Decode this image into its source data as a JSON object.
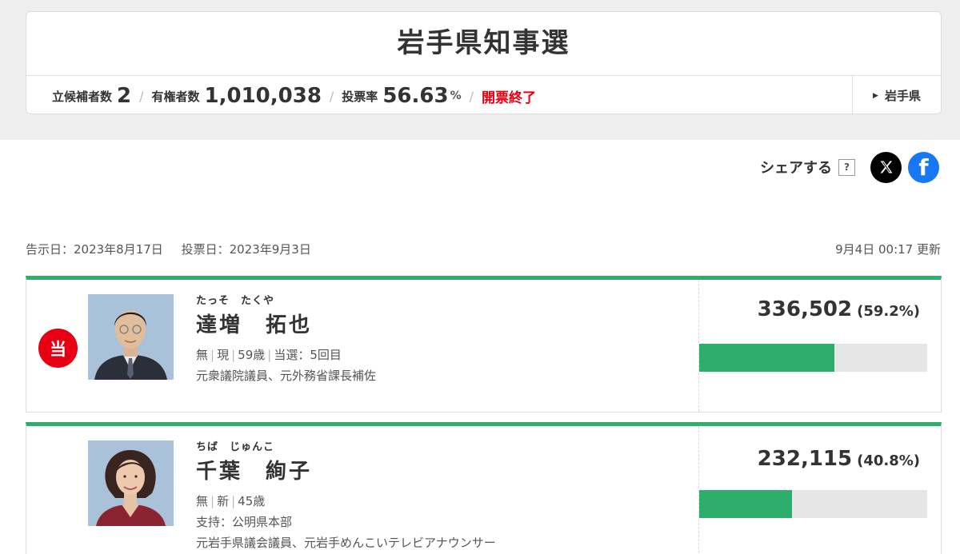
{
  "header": {
    "title": "岩手県知事選",
    "candidates_label": "立候補者数",
    "candidates_value": "2",
    "voters_label": "有権者数",
    "voters_value": "1,010,038",
    "turnout_label": "投票率",
    "turnout_value": "56.63",
    "turnout_unit": "%",
    "status": "開票終了",
    "pref_link": "岩手県"
  },
  "share": {
    "label": "シェアする",
    "help": "?",
    "x_icon": "x-logo-icon",
    "fb_icon": "facebook-logo-icon"
  },
  "dates": {
    "notice": "告示日：2023年8月17日",
    "vote": "投票日：2023年9月3日",
    "updated": "9月4日 00:17 更新"
  },
  "candidates": [
    {
      "badge": "当",
      "furigana": "たっそ　たくや",
      "name": "達増　拓也",
      "party": "無",
      "status": "現",
      "age": "59歳",
      "terms": "当選：5回目",
      "support": "",
      "career": "元衆議院議員、元外務省課長補佐",
      "votes": "336,502",
      "percent": "(59.2%)",
      "share": 0.592
    },
    {
      "badge": "",
      "furigana": "ちば　じゅんこ",
      "name": "千葉　絢子",
      "party": "無",
      "status": "新",
      "age": "45歳",
      "terms": "",
      "support": "支持：公明県本部",
      "career": "元岩手県議会議員、元岩手めんこいテレビアナウンサー",
      "votes": "232,115",
      "percent": "(40.8%)",
      "share": 0.408
    }
  ],
  "colors": {
    "accent": "#2daf6b",
    "winner": "#e60012",
    "twitter": "#000000",
    "facebook": "#1877f2"
  }
}
